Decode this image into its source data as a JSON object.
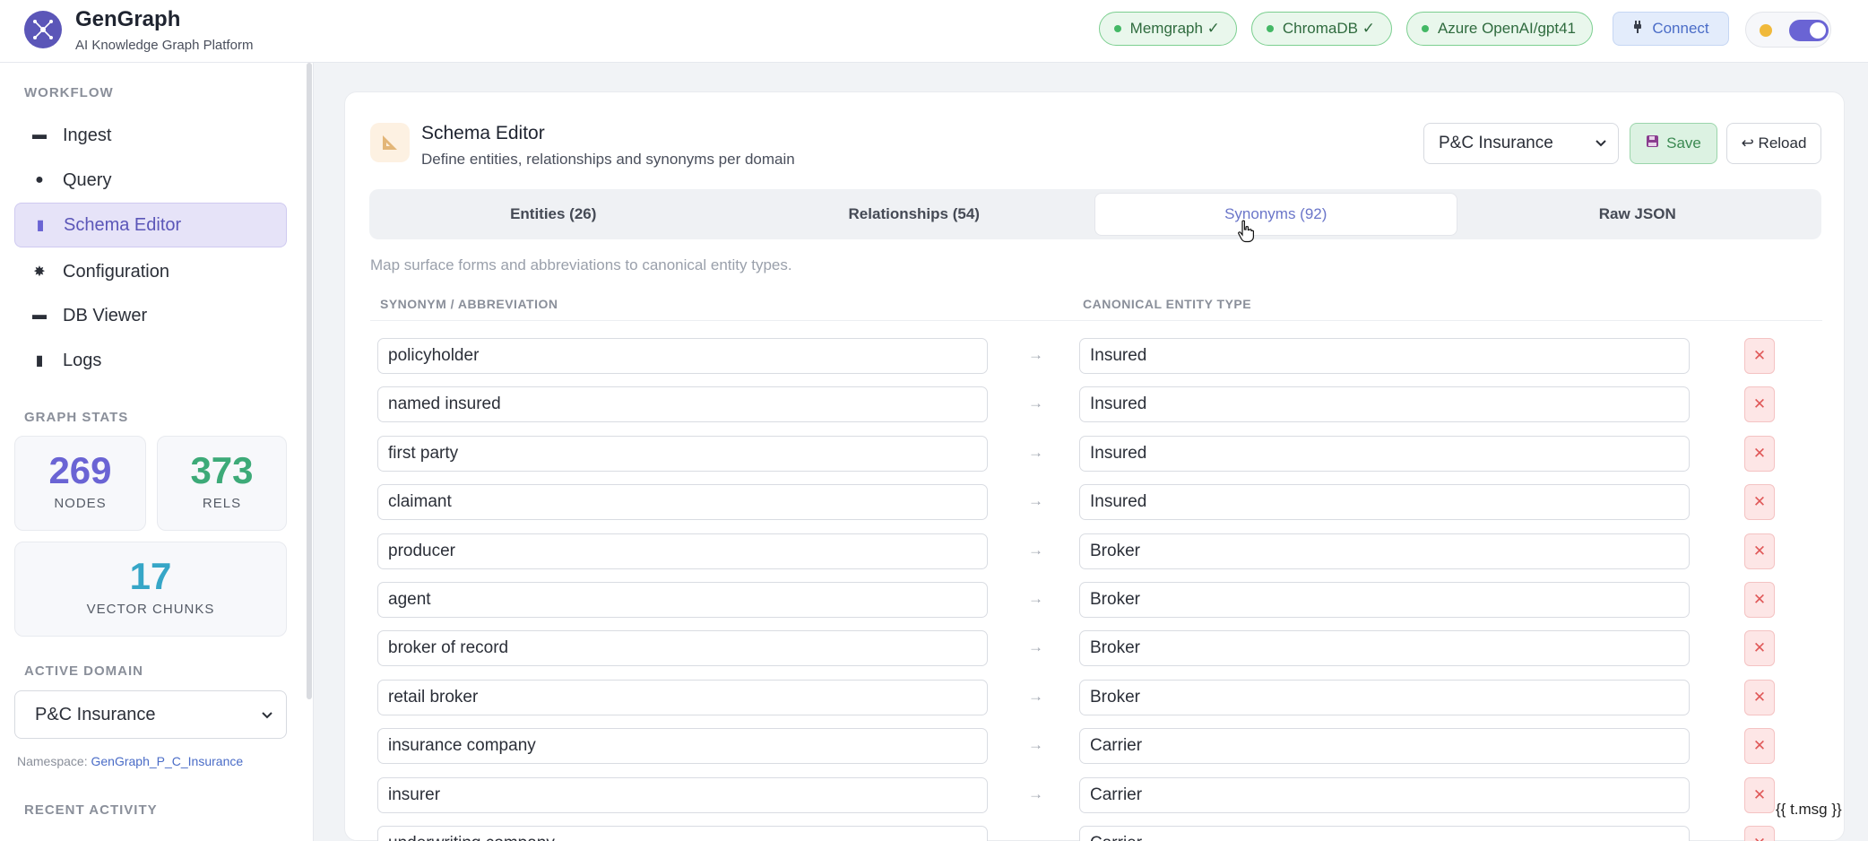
{
  "header": {
    "title": "GenGraph",
    "subtitle": "AI Knowledge Graph Platform",
    "status": [
      "Memgraph ✓",
      "ChromaDB ✓",
      "Azure OpenAI/gpt41"
    ],
    "connect_label": "Connect"
  },
  "sidebar": {
    "workflow_heading": "WORKFLOW",
    "items": [
      {
        "label": "Ingest",
        "icon": "ingest-icon"
      },
      {
        "label": "Query",
        "icon": "query-icon"
      },
      {
        "label": "Schema Editor",
        "icon": "schema-icon",
        "active": true
      },
      {
        "label": "Configuration",
        "icon": "gear-icon"
      },
      {
        "label": "DB Viewer",
        "icon": "database-icon"
      },
      {
        "label": "Logs",
        "icon": "logs-icon"
      }
    ],
    "stats_heading": "GRAPH STATS",
    "stats": {
      "nodes_value": "269",
      "nodes_label": "NODES",
      "rels_value": "373",
      "rels_label": "RELS",
      "chunks_value": "17",
      "chunks_label": "VECTOR CHUNKS"
    },
    "domain_heading": "ACTIVE DOMAIN",
    "domain_value": "P&C Insurance",
    "namespace_label": "Namespace:",
    "namespace_value": "GenGraph_P_C_Insurance",
    "recent_heading": "RECENT ACTIVITY"
  },
  "panel": {
    "title": "Schema Editor",
    "subtitle": "Define entities, relationships and synonyms per domain",
    "domain_select": "P&C Insurance",
    "save_label": "Save",
    "reload_label": "↩ Reload",
    "tabs": [
      "Entities (26)",
      "Relationships (54)",
      "Synonyms (92)",
      "Raw JSON"
    ],
    "active_tab": "Synonyms (92)",
    "description": "Map surface forms and abbreviations to canonical entity types.",
    "col_synonym": "SYNONYM / ABBREVIATION",
    "col_canonical": "CANONICAL ENTITY TYPE",
    "rows": [
      {
        "synonym": "policyholder",
        "canonical": "Insured"
      },
      {
        "synonym": "named insured",
        "canonical": "Insured"
      },
      {
        "synonym": "first party",
        "canonical": "Insured"
      },
      {
        "synonym": "claimant",
        "canonical": "Insured"
      },
      {
        "synonym": "producer",
        "canonical": "Broker"
      },
      {
        "synonym": "agent",
        "canonical": "Broker"
      },
      {
        "synonym": "broker of record",
        "canonical": "Broker"
      },
      {
        "synonym": "retail broker",
        "canonical": "Broker"
      },
      {
        "synonym": "insurance company",
        "canonical": "Carrier"
      },
      {
        "synonym": "insurer",
        "canonical": "Carrier"
      },
      {
        "synonym": "underwriting company",
        "canonical": "Carrier"
      }
    ]
  },
  "footer_msg": "{{ t.msg }}",
  "colors": {
    "accent": "#6a64d4",
    "success": "#43b865",
    "danger": "#e05858",
    "nodes": "#6a64d4",
    "rels": "#3daa78",
    "chunks": "#36a6c7"
  }
}
